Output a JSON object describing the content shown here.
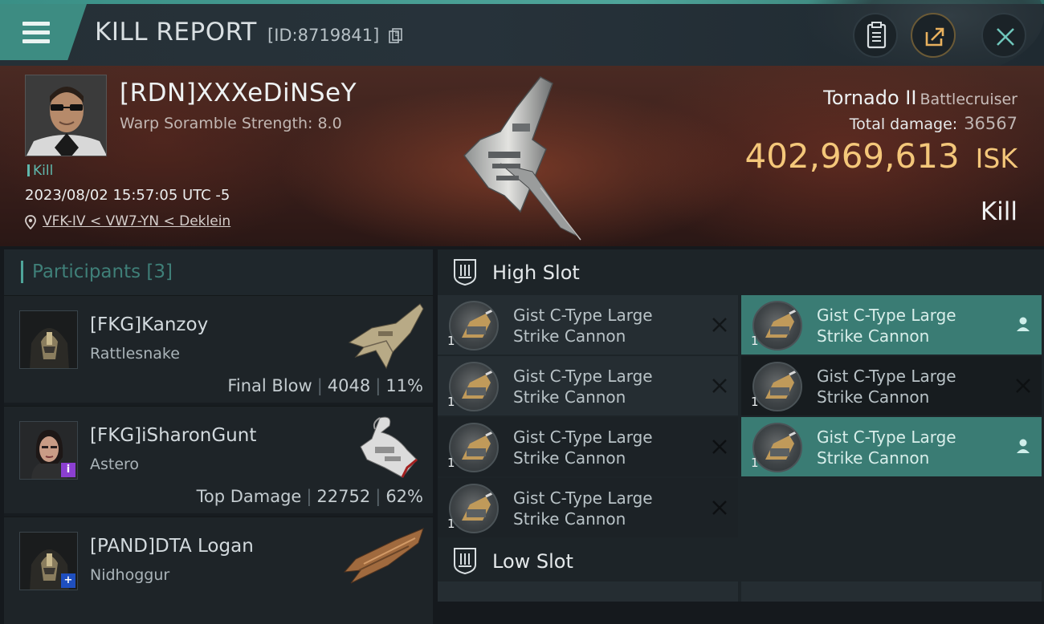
{
  "header": {
    "title": "KILL REPORT",
    "report_id": "[ID:8719841]"
  },
  "victim": {
    "name": "[RDN]XXXeDiNSeY",
    "warp_scramble": "Warp Soramble Strength: 8.0",
    "tag": "Kill",
    "date": "2023/08/02 15:57:05 UTC -5",
    "location": "VFK-IV < VW7-YN < Deklein",
    "ship_name": "Tornado II",
    "ship_class": "Battlecruiser",
    "total_damage_label": "Total damage:",
    "total_damage": "36567",
    "isk_value": "402,969,613",
    "isk_unit": "ISK",
    "result": "Kill"
  },
  "participants": {
    "title": "Participants",
    "count": "[3]",
    "rows": [
      {
        "name": "[FKG]Kanzoy",
        "ship": "Rattlesnake",
        "role": "Final Blow",
        "damage": "4048",
        "pct": "11%",
        "badge": ""
      },
      {
        "name": "[FKG]iSharonGunt",
        "ship": "Astero",
        "role": "Top Damage",
        "damage": "22752",
        "pct": "62%",
        "badge": "i"
      },
      {
        "name": "[PAND]DTA Logan",
        "ship": "Nidhoggur",
        "role": "",
        "damage": "",
        "pct": "",
        "badge": "+"
      }
    ]
  },
  "fitting": {
    "high_slot_title": "High Slot",
    "low_slot_title": "Low Slot",
    "modules": [
      {
        "name1": "Gist C-Type Large",
        "name2": "Strike Cannon",
        "qty": "1",
        "action": "x",
        "state": "normal"
      },
      {
        "name1": "Gist C-Type Large",
        "name2": "Strike Cannon",
        "qty": "1",
        "action": "user",
        "state": "selected"
      },
      {
        "name1": "Gist C-Type Large",
        "name2": "Strike Cannon",
        "qty": "1",
        "action": "x",
        "state": "normal"
      },
      {
        "name1": "Gist C-Type Large",
        "name2": "Strike Cannon",
        "qty": "1",
        "action": "x",
        "state": "dark"
      },
      {
        "name1": "Gist C-Type Large",
        "name2": "Strike Cannon",
        "qty": "1",
        "action": "x",
        "state": "alt"
      },
      {
        "name1": "Gist C-Type Large",
        "name2": "Strike Cannon",
        "qty": "1",
        "action": "user",
        "state": "selected"
      },
      {
        "name1": "Gist C-Type Large",
        "name2": "Strike Cannon",
        "qty": "1",
        "action": "x",
        "state": "normal"
      }
    ]
  },
  "colors": {
    "accent": "#3d8c82",
    "isk": "#f4c77a",
    "selected_module": "#3a7c74"
  },
  "icons": [
    "menu-icon",
    "copy-icon",
    "clipboard-icon",
    "share-icon",
    "close-icon",
    "pin-icon",
    "slot-icon",
    "close-x-icon",
    "user-icon"
  ]
}
